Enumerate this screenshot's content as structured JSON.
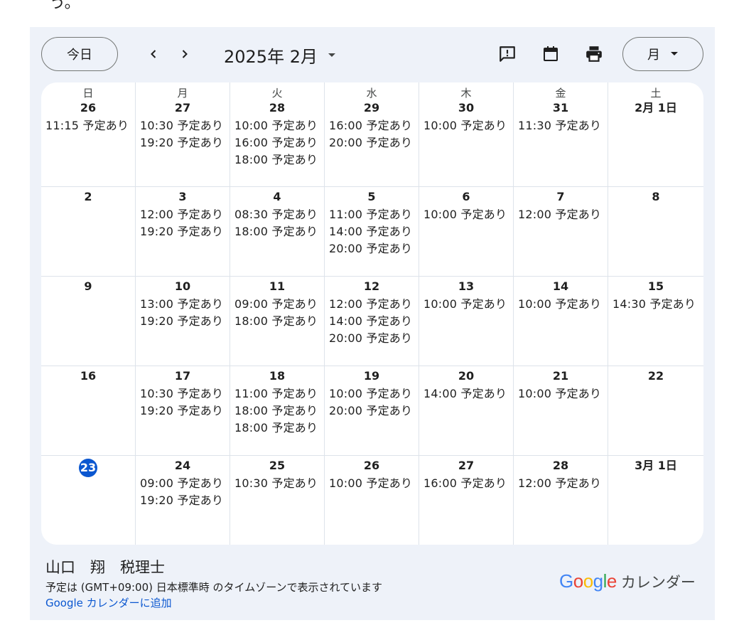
{
  "page_fragment": "う。",
  "toolbar": {
    "today_label": "今日",
    "month_title": "2025年 2月",
    "view_label": "月"
  },
  "icons": {
    "prev": "chevron-left-icon",
    "next": "chevron-right-icon",
    "title_dropdown": "caret-down-icon",
    "feedback": "feedback-icon",
    "calendar": "calendar-icon",
    "print": "print-icon",
    "view_dropdown": "caret-down-icon"
  },
  "calendar": {
    "weekdays": [
      "日",
      "月",
      "火",
      "水",
      "木",
      "金",
      "土"
    ],
    "weeks": [
      [
        {
          "day": "26",
          "events": [
            "11:15 予定あり"
          ]
        },
        {
          "day": "27",
          "events": [
            "10:30 予定あり",
            "19:20 予定あり"
          ]
        },
        {
          "day": "28",
          "events": [
            "10:00 予定あり",
            "16:00 予定あり",
            "18:00 予定あり"
          ]
        },
        {
          "day": "29",
          "events": [
            "16:00 予定あり",
            "20:00 予定あり"
          ]
        },
        {
          "day": "30",
          "events": [
            "10:00 予定あり"
          ]
        },
        {
          "day": "31",
          "events": [
            "11:30 予定あり"
          ]
        },
        {
          "day": "2月 1日",
          "events": []
        }
      ],
      [
        {
          "day": "2",
          "events": []
        },
        {
          "day": "3",
          "events": [
            "12:00 予定あり",
            "19:20 予定あり"
          ]
        },
        {
          "day": "4",
          "events": [
            "08:30 予定あり",
            "18:00 予定あり"
          ]
        },
        {
          "day": "5",
          "events": [
            "11:00 予定あり",
            "14:00 予定あり",
            "20:00 予定あり"
          ]
        },
        {
          "day": "6",
          "events": [
            "10:00 予定あり"
          ]
        },
        {
          "day": "7",
          "events": [
            "12:00 予定あり"
          ]
        },
        {
          "day": "8",
          "events": []
        }
      ],
      [
        {
          "day": "9",
          "events": []
        },
        {
          "day": "10",
          "events": [
            "13:00 予定あり",
            "19:20 予定あり"
          ]
        },
        {
          "day": "11",
          "events": [
            "09:00 予定あり",
            "18:00 予定あり"
          ]
        },
        {
          "day": "12",
          "events": [
            "12:00 予定あり",
            "14:00 予定あり",
            "20:00 予定あり"
          ]
        },
        {
          "day": "13",
          "events": [
            "10:00 予定あり"
          ]
        },
        {
          "day": "14",
          "events": [
            "10:00 予定あり"
          ]
        },
        {
          "day": "15",
          "events": [
            "14:30 予定あり"
          ]
        }
      ],
      [
        {
          "day": "16",
          "events": []
        },
        {
          "day": "17",
          "events": [
            "10:30 予定あり",
            "19:20 予定あり"
          ]
        },
        {
          "day": "18",
          "events": [
            "11:00 予定あり",
            "18:00 予定あり",
            "18:00 予定あり"
          ]
        },
        {
          "day": "19",
          "events": [
            "10:00 予定あり",
            "20:00 予定あり"
          ]
        },
        {
          "day": "20",
          "events": [
            "14:00 予定あり"
          ]
        },
        {
          "day": "21",
          "events": [
            "10:00 予定あり"
          ]
        },
        {
          "day": "22",
          "events": []
        }
      ],
      [
        {
          "day": "23",
          "events": [],
          "today": true
        },
        {
          "day": "24",
          "events": [
            "09:00 予定あり",
            "19:20 予定あり"
          ]
        },
        {
          "day": "25",
          "events": [
            "10:30 予定あり"
          ]
        },
        {
          "day": "26",
          "events": [
            "10:00 予定あり"
          ]
        },
        {
          "day": "27",
          "events": [
            "16:00 予定あり"
          ]
        },
        {
          "day": "28",
          "events": [
            "12:00 予定あり"
          ]
        },
        {
          "day": "3月 1日",
          "events": []
        }
      ]
    ]
  },
  "footer": {
    "owner_name": "山口　翔　税理士",
    "timezone_note": "予定は (GMT+09:00) 日本標準時 のタイムゾーンで表示されています",
    "add_link": "Google カレンダーに追加",
    "brand_logo": "Google",
    "brand_text": "カレンダー"
  },
  "colors": {
    "accent": "#0b57d0",
    "panel_bg": "#eef2f9",
    "border": "#dde3ea",
    "google_blue": "#4285F4",
    "google_red": "#EA4335",
    "google_yellow": "#FBBC05",
    "google_green": "#34A853"
  }
}
